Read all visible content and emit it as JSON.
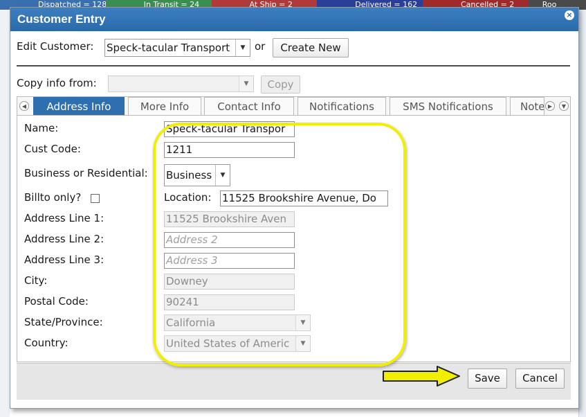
{
  "background": {
    "cells": [
      {
        "text": "Dispatched = 128",
        "color": "#3a6fb0"
      },
      {
        "text": "In Transit = 24",
        "color": "#3a8f50"
      },
      {
        "text": "At Ship = 2",
        "color": "#b03a3a"
      },
      {
        "text": "Delivered = 162",
        "color": "#2a3f9a"
      },
      {
        "text": "Cancelled = 2",
        "color": "#a02a2a"
      },
      {
        "text": "Roo",
        "color": "#4a4a4a"
      }
    ]
  },
  "dialog": {
    "title": "Customer Entry",
    "close_glyph": "×"
  },
  "edit_customer": {
    "label": "Edit Customer:",
    "selected": "Speck-tacular Transport",
    "or_text": "or",
    "create_new_label": "Create New"
  },
  "copy_info": {
    "label": "Copy info from:",
    "selected": "",
    "copy_label": "Copy"
  },
  "tabs": [
    {
      "label": "Address Info",
      "active": true
    },
    {
      "label": "More Info",
      "active": false
    },
    {
      "label": "Contact Info",
      "active": false
    },
    {
      "label": "Notifications",
      "active": false
    },
    {
      "label": "SMS Notifications",
      "active": false
    },
    {
      "label": "Note",
      "active": false
    }
  ],
  "tab_nav": {
    "prev": "◀",
    "next": "▶",
    "menu": "▼"
  },
  "form": {
    "name_label": "Name:",
    "name_value": "Speck-tacular Transpor",
    "cust_code_label": "Cust Code:",
    "cust_code_value": "1211",
    "business_label": "Business or Residential:",
    "business_value": "Business",
    "billto_label": "Billto only?",
    "billto_checked": false,
    "location_label": "Location:",
    "location_value": "11525 Brookshire Avenue, Do",
    "address1_label": "Address Line 1:",
    "address1_value": "11525 Brookshire Aven",
    "address2_label": "Address Line 2:",
    "address2_placeholder": "Address 2",
    "address3_label": "Address Line 3:",
    "address3_placeholder": "Address 3",
    "city_label": "City:",
    "city_value": "Downey",
    "postal_label": "Postal Code:",
    "postal_value": "90241",
    "state_label": "State/Province:",
    "state_value": "California",
    "country_label": "Country:",
    "country_value": "United States of Americ"
  },
  "footer": {
    "save_label": "Save",
    "cancel_label": "Cancel"
  },
  "annotation": {
    "highlight_color": "#f2ee00",
    "arrow_color": "#f2ee00"
  }
}
